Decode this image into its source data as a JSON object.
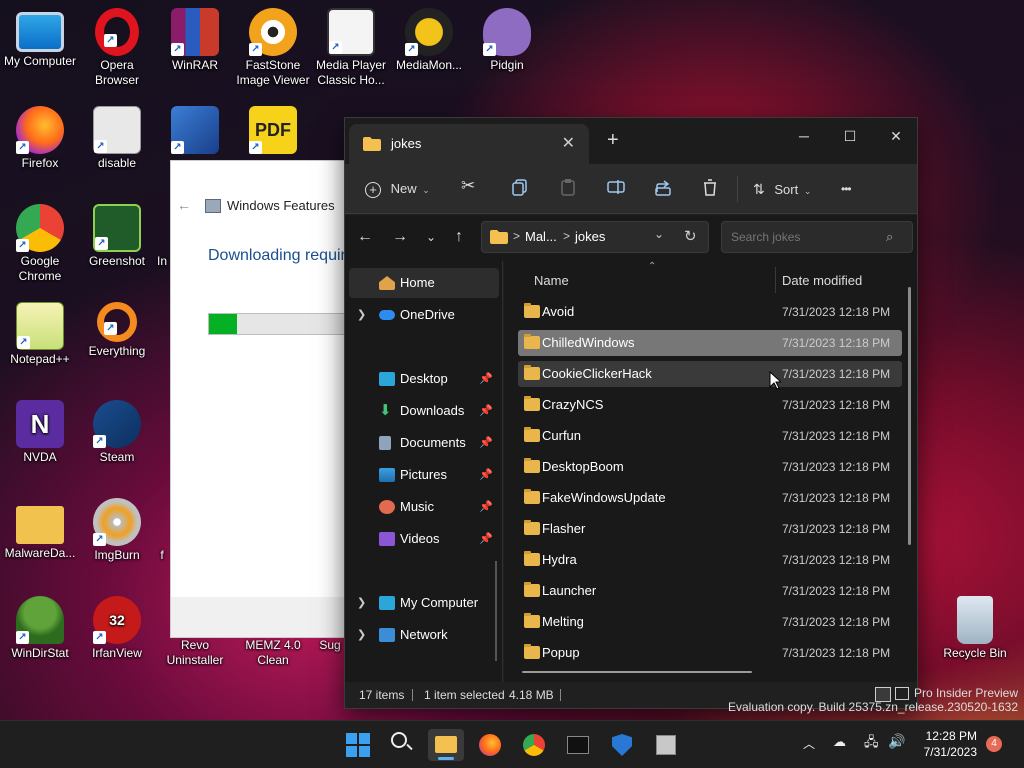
{
  "desktop": {
    "icons": [
      {
        "label": "My Computer"
      },
      {
        "label": "Opera Browser"
      },
      {
        "label": "WinRAR"
      },
      {
        "label": "FastStone Image Viewer"
      },
      {
        "label": "Media Player Classic Ho..."
      },
      {
        "label": "MediaMon..."
      },
      {
        "label": "Pidgin"
      },
      {
        "label": "Firefox"
      },
      {
        "label": "disable"
      },
      {
        "label": "Google Chrome"
      },
      {
        "label": "Greenshot"
      },
      {
        "label": "In"
      },
      {
        "label": "Notepad++"
      },
      {
        "label": "Everything"
      },
      {
        "label": "NVDA"
      },
      {
        "label": "Steam"
      },
      {
        "label": "MalwareDa..."
      },
      {
        "label": "ImgBurn"
      },
      {
        "label": "f"
      },
      {
        "label": "WinDirStat"
      },
      {
        "label": "IrfanView"
      },
      {
        "label": "Revo Uninstaller"
      },
      {
        "label": "MEMZ 4.0 Clean"
      },
      {
        "label": "Sug"
      },
      {
        "label": "Recycle Bin"
      },
      {
        "label": "32"
      }
    ]
  },
  "features_dialog": {
    "title": "Windows Features",
    "message": "Downloading requir",
    "progress": 0.18
  },
  "explorer": {
    "tab_title": "jokes",
    "new_tab_icon": "+",
    "toolbar": {
      "new_label": "New",
      "sort_label": "Sort",
      "more_icon": "•••"
    },
    "address": {
      "crumb1": "Mal...",
      "crumb2": "jokes",
      "sep": ">"
    },
    "search_placeholder": "Search jokes",
    "nav": {
      "home": "Home",
      "onedrive": "OneDrive",
      "desktop": "Desktop",
      "downloads": "Downloads",
      "documents": "Documents",
      "pictures": "Pictures",
      "music": "Music",
      "videos": "Videos",
      "mycomputer": "My Computer",
      "network": "Network"
    },
    "columns": {
      "name": "Name",
      "date": "Date modified"
    },
    "files": [
      {
        "name": "Avoid",
        "date": "7/31/2023 12:18 PM"
      },
      {
        "name": "ChilledWindows",
        "date": "7/31/2023 12:18 PM"
      },
      {
        "name": "CookieClickerHack",
        "date": "7/31/2023 12:18 PM"
      },
      {
        "name": "CrazyNCS",
        "date": "7/31/2023 12:18 PM"
      },
      {
        "name": "Curfun",
        "date": "7/31/2023 12:18 PM"
      },
      {
        "name": "DesktopBoom",
        "date": "7/31/2023 12:18 PM"
      },
      {
        "name": "FakeWindowsUpdate",
        "date": "7/31/2023 12:18 PM"
      },
      {
        "name": "Flasher",
        "date": "7/31/2023 12:18 PM"
      },
      {
        "name": "Hydra",
        "date": "7/31/2023 12:18 PM"
      },
      {
        "name": "Launcher",
        "date": "7/31/2023 12:18 PM"
      },
      {
        "name": "Melting",
        "date": "7/31/2023 12:18 PM"
      },
      {
        "name": "Popup",
        "date": "7/31/2023 12:18 PM"
      }
    ],
    "status": {
      "count": "17 items",
      "selected": "1 item selected",
      "size": "4.18 MB"
    }
  },
  "watermark": {
    "line1": "Pro Insider Preview",
    "line2": "Evaluation copy. Build 25375.zn_release.230520-1632"
  },
  "taskbar": {
    "time": "12:28 PM",
    "date": "7/31/2023",
    "notifications": "4"
  }
}
